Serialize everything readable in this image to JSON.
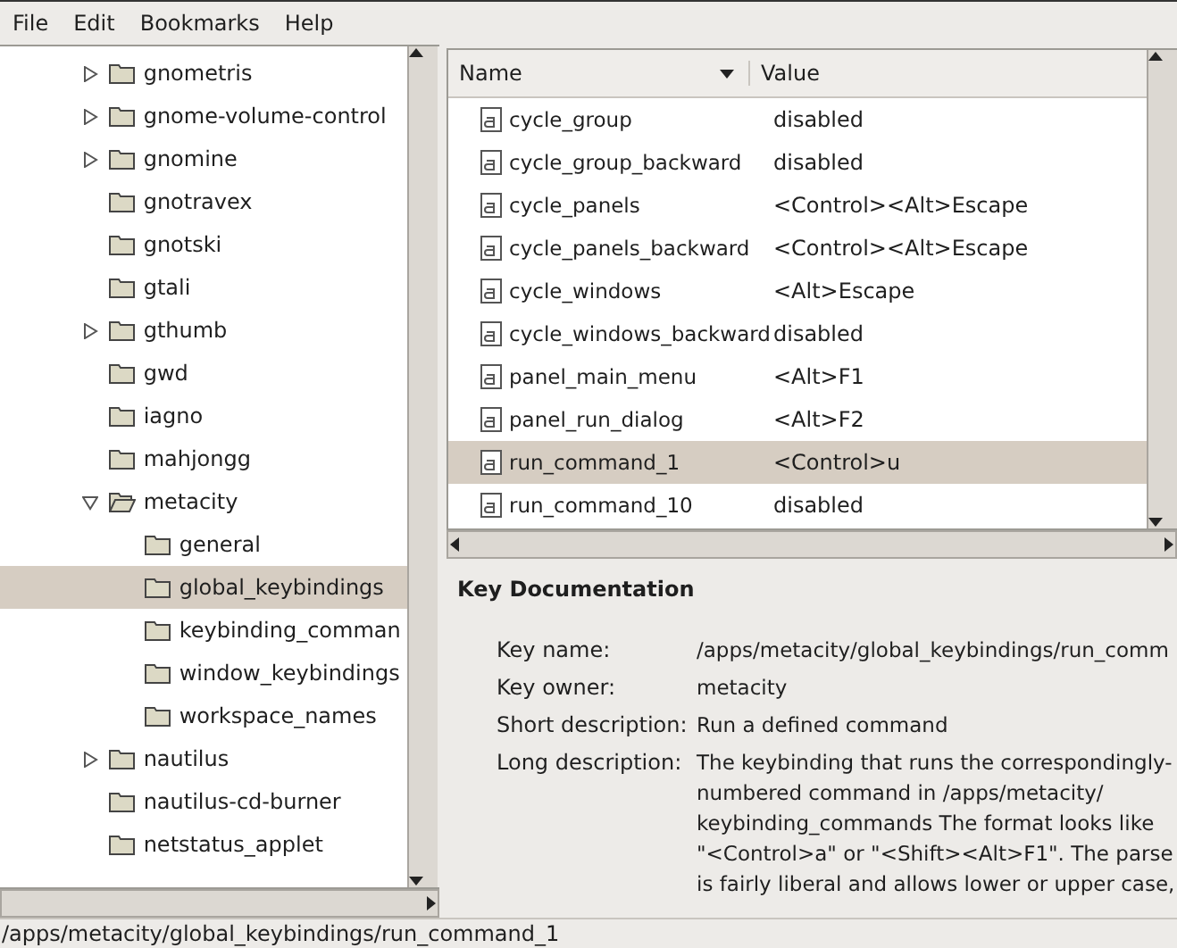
{
  "menu": [
    "File",
    "Edit",
    "Bookmarks",
    "Help"
  ],
  "tree": [
    {
      "label": "gnometris",
      "kind": "branch",
      "expanded": false,
      "selected": false
    },
    {
      "label": "gnome-volume-control",
      "kind": "branch",
      "expanded": false,
      "selected": false
    },
    {
      "label": "gnomine",
      "kind": "branch",
      "expanded": false,
      "selected": false
    },
    {
      "label": "gnotravex",
      "kind": "leaf",
      "selected": false
    },
    {
      "label": "gnotski",
      "kind": "leaf",
      "selected": false
    },
    {
      "label": "gtali",
      "kind": "leaf",
      "selected": false
    },
    {
      "label": "gthumb",
      "kind": "branch",
      "expanded": false,
      "selected": false
    },
    {
      "label": "gwd",
      "kind": "leaf",
      "selected": false
    },
    {
      "label": "iagno",
      "kind": "leaf",
      "selected": false
    },
    {
      "label": "mahjongg",
      "kind": "leaf",
      "selected": false
    },
    {
      "label": "metacity",
      "kind": "branch",
      "expanded": true,
      "selected": false,
      "children": [
        {
          "label": "general",
          "kind": "leaf",
          "selected": false
        },
        {
          "label": "global_keybindings",
          "kind": "leaf",
          "selected": true
        },
        {
          "label": "keybinding_comman",
          "kind": "leaf",
          "selected": false
        },
        {
          "label": "window_keybindings",
          "kind": "leaf",
          "selected": false
        },
        {
          "label": "workspace_names",
          "kind": "leaf",
          "selected": false
        }
      ]
    },
    {
      "label": "nautilus",
      "kind": "branch",
      "expanded": false,
      "selected": false
    },
    {
      "label": "nautilus-cd-burner",
      "kind": "leaf",
      "selected": false
    },
    {
      "label": "netstatus_applet",
      "kind": "leaf",
      "selected": false
    }
  ],
  "table": {
    "columns": [
      "Name",
      "Value"
    ],
    "rows": [
      {
        "name": "cycle_group",
        "value": "disabled",
        "selected": false
      },
      {
        "name": "cycle_group_backward",
        "value": "disabled",
        "selected": false
      },
      {
        "name": "cycle_panels",
        "value": "<Control><Alt>Escape",
        "selected": false
      },
      {
        "name": "cycle_panels_backward",
        "value": "<Control><Alt>Escape",
        "selected": false
      },
      {
        "name": "cycle_windows",
        "value": "<Alt>Escape",
        "selected": false
      },
      {
        "name": "cycle_windows_backward",
        "value": "disabled",
        "selected": false
      },
      {
        "name": "panel_main_menu",
        "value": "<Alt>F1",
        "selected": false
      },
      {
        "name": "panel_run_dialog",
        "value": "<Alt>F2",
        "selected": false
      },
      {
        "name": "run_command_1",
        "value": "<Control>u",
        "selected": true
      },
      {
        "name": "run_command_10",
        "value": "disabled",
        "selected": false
      }
    ]
  },
  "documentation": {
    "title": "Key Documentation",
    "fields": [
      {
        "label": "Key name:",
        "lines": [
          "/apps/metacity/global_keybindings/run_comm"
        ]
      },
      {
        "label": "Key owner:",
        "lines": [
          "metacity"
        ]
      },
      {
        "label": "Short description:",
        "lines": [
          "Run a defined command"
        ]
      },
      {
        "label": "Long description:",
        "lines": [
          "The keybinding that runs the correspondingly-",
          "numbered command in /apps/metacity/",
          "keybinding_commands The format looks like",
          "\"<Control>a\" or \"<Shift><Alt>F1\". The parse",
          "is fairly liberal and allows lower or upper case,"
        ]
      }
    ]
  },
  "status_bar": "/apps/metacity/global_keybindings/run_command_1"
}
